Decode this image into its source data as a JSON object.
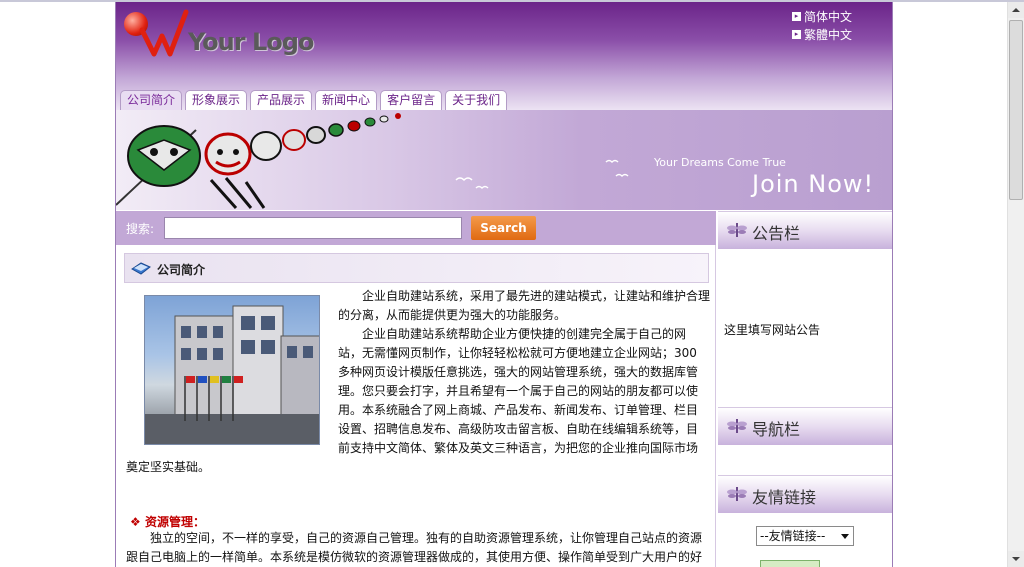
{
  "header": {
    "logo_text": "Your Logo",
    "languages": [
      {
        "label": "简体中文",
        "icon": "square-arrow-icon"
      },
      {
        "label": "繁體中文",
        "icon": "square-arrow-icon"
      }
    ]
  },
  "nav": {
    "tabs": [
      {
        "label": "公司简介",
        "active": true
      },
      {
        "label": "形象展示",
        "active": false
      },
      {
        "label": "产品展示",
        "active": false
      },
      {
        "label": "新闻中心",
        "active": false
      },
      {
        "label": "客户留言",
        "active": false
      },
      {
        "label": "关于我们",
        "active": false
      }
    ]
  },
  "banner": {
    "tagline": "Your Dreams Come True",
    "cta": "Join Now!"
  },
  "search": {
    "label": "搜索:",
    "value": "",
    "button": "Search"
  },
  "main": {
    "section_title": "公司简介",
    "intro_p1": "企业自助建站系统，采用了最先进的建站模式，让建站和维护合理的分离，从而能提供更为强大的功能服务。",
    "intro_p2_lines": [
      "企业自助建站系统帮助企业方便快捷的创建完全属于自己的网",
      "站，无需懂网页制作，让你轻轻松松就可方便地建立企业网站；300",
      "多种网页设计模版任意挑选，强大的网站管理系统，强大的数据库管",
      "理。您只要会打字，并且希望有一个属于自己的网站的朋友都可以使",
      "用。本系统融合了网上商城、产品发布、新闻发布、订单管理、栏目",
      "设置、招聘信息发布、高级防攻击留言板、自助在线编辑系统等，目",
      "前支持中文简体、繁体及英文三种语言，为把您的企业推向国际市场"
    ],
    "intro_p2_tail": "奠定坚实基础。",
    "feature_title": "资源管理：",
    "feature_lines": [
      "独立的空间，不一样的享受，自己的资源自己管理。独有的自助资源管理系统，让你管理自己站点的资源",
      "跟自己电脑上的一样简单。本系统是模仿微软的资源管理器做成的，其使用方便、操作简单受到广大用户的好"
    ]
  },
  "sidebar": {
    "notice_title": "公告栏",
    "notice_text": "这里填写网站公告",
    "nav_title": "导航栏",
    "links_title": "友情链接",
    "links_select": "--友情链接--"
  }
}
